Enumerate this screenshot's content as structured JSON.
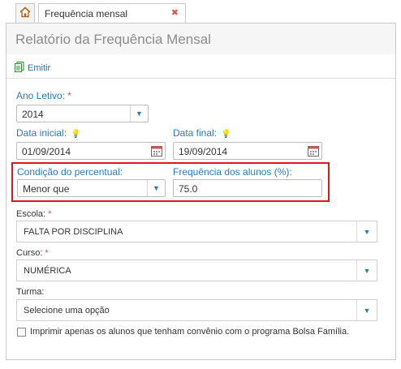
{
  "tab": {
    "label": "Frequência mensal",
    "close": "✖"
  },
  "page": {
    "title": "Relatório da Frequência Mensal"
  },
  "toolbar": {
    "emit_label": "Emitir"
  },
  "form": {
    "ano_letivo": {
      "label": "Ano Letivo:",
      "required": "*",
      "value": "2014"
    },
    "data_inicial": {
      "label": "Data inicial:",
      "value": "01/09/2014"
    },
    "data_final": {
      "label": "Data final:",
      "value": "19/09/2014"
    },
    "condicao": {
      "label": "Condição do percentual:",
      "value": "Menor que"
    },
    "frequencia": {
      "label": "Frequência dos alunos (%):",
      "value": "75.0"
    },
    "escola": {
      "label": "Escola:",
      "required": "*",
      "value": "FALTA POR DISCIPLINA"
    },
    "curso": {
      "label": "Curso:",
      "required": "*",
      "value": "NUMÉRICA"
    },
    "turma": {
      "label": "Turma:",
      "value": "Selecione uma opção"
    },
    "bolsa": {
      "label": "Imprimir apenas os alunos que tenham convênio com o programa Bolsa Família."
    }
  },
  "colors": {
    "accent": "#2a7ab8",
    "required": "#d9534f",
    "highlight": "#d71a1f"
  },
  "icons": {
    "home": "home-icon",
    "emit": "document-icon",
    "calendar": "calendar-icon",
    "hint": "lightbulb-icon",
    "dropdown": "chevron-down-icon"
  }
}
